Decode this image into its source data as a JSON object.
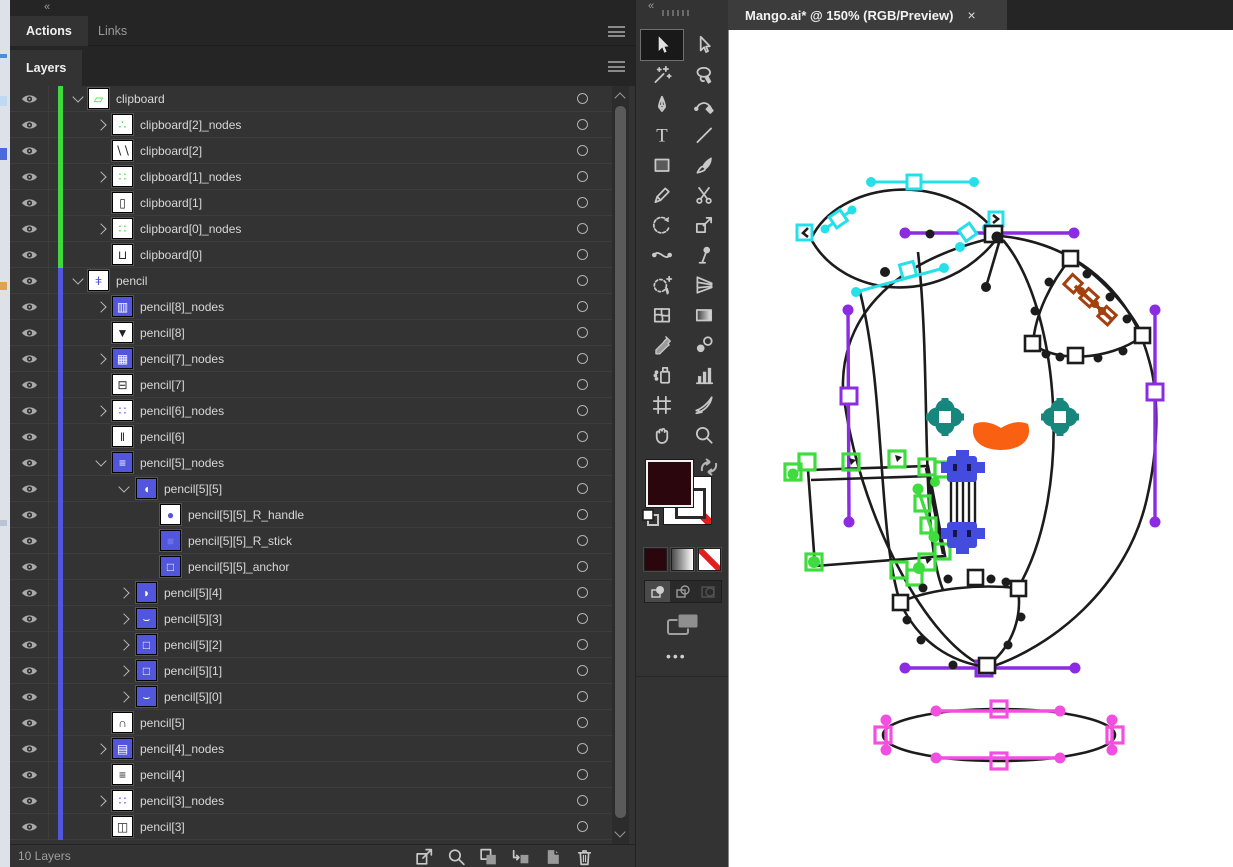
{
  "theme": {
    "panel-bg": "#333333",
    "panel-dark": "#252526",
    "row-line": "#3d3d3d",
    "text": "#d8d8d8",
    "dim": "#8f8f8f",
    "icon": "#bdbdbd",
    "accent-green": "#3fd83f",
    "accent-blue": "#5156dd",
    "tab-bg": "#3c3c3c",
    "fill-maroon": "#2b060c",
    "art-k": "#1c1c1c",
    "art-cyan": "#25dfe9",
    "art-purple": "#8b2be2",
    "art-brown": "#a34010",
    "art-teal": "#17877d",
    "art-orange": "#f96011",
    "art-green": "#3fdc3f",
    "art-blue": "#444ce0",
    "art-pink": "#f24fe0"
  },
  "header": {
    "collapse_left": "«",
    "collapse_toolbar": "«"
  },
  "panel": {
    "tabs": [
      {
        "label": "Actions",
        "active": true
      },
      {
        "label": "Links",
        "active": false
      }
    ],
    "layers_tab": "Layers",
    "status_count": "10 Layers",
    "footer_icons": [
      "collect-for-export",
      "search",
      "make-clip-mask",
      "new-sublayer",
      "new-layer",
      "delete"
    ]
  },
  "layers": {
    "rows": [
      {
        "label": "clipboard",
        "accent": "green",
        "level": 0,
        "exp": "open",
        "thumb": {
          "bg": "#ffffff",
          "fg": "#3fd83f",
          "glyph": "▱"
        }
      },
      {
        "label": "clipboard[2]_nodes",
        "accent": "green",
        "level": 1,
        "exp": "closed",
        "thumb": {
          "bg": "#ffffff",
          "fg": "#3fd83f",
          "glyph": "∴"
        }
      },
      {
        "label": "clipboard[2]",
        "accent": "green",
        "level": 1,
        "exp": "none",
        "thumb": {
          "bg": "#ffffff",
          "fg": "#222222",
          "glyph": "∖∖"
        }
      },
      {
        "label": "clipboard[1]_nodes",
        "accent": "green",
        "level": 1,
        "exp": "closed",
        "thumb": {
          "bg": "#ffffff",
          "fg": "#3fd83f",
          "glyph": "∷"
        }
      },
      {
        "label": "clipboard[1]",
        "accent": "green",
        "level": 1,
        "exp": "none",
        "thumb": {
          "bg": "#ffffff",
          "fg": "#222222",
          "glyph": "▯"
        }
      },
      {
        "label": "clipboard[0]_nodes",
        "accent": "green",
        "level": 1,
        "exp": "closed",
        "thumb": {
          "bg": "#ffffff",
          "fg": "#3fd83f",
          "glyph": "∷"
        }
      },
      {
        "label": "clipboard[0]",
        "accent": "green",
        "level": 1,
        "exp": "none",
        "thumb": {
          "bg": "#ffffff",
          "fg": "#222222",
          "glyph": "⊔"
        }
      },
      {
        "label": "pencil",
        "accent": "blue",
        "level": 0,
        "exp": "open",
        "thumb": {
          "bg": "#ffffff",
          "fg": "#5156dd",
          "glyph": "ǂ"
        }
      },
      {
        "label": "pencil[8]_nodes",
        "accent": "blue",
        "level": 1,
        "exp": "closed",
        "thumb": {
          "bg": "#5156dd",
          "fg": "#ffffff",
          "glyph": "▥"
        }
      },
      {
        "label": "pencil[8]",
        "accent": "blue",
        "level": 1,
        "exp": "none",
        "thumb": {
          "bg": "#ffffff",
          "fg": "#222222",
          "glyph": "▼"
        }
      },
      {
        "label": "pencil[7]_nodes",
        "accent": "blue",
        "level": 1,
        "exp": "closed",
        "thumb": {
          "bg": "#5156dd",
          "fg": "#ffffff",
          "glyph": "▦"
        }
      },
      {
        "label": "pencil[7]",
        "accent": "blue",
        "level": 1,
        "exp": "none",
        "thumb": {
          "bg": "#ffffff",
          "fg": "#222222",
          "glyph": "⊟"
        }
      },
      {
        "label": "pencil[6]_nodes",
        "accent": "blue",
        "level": 1,
        "exp": "closed",
        "thumb": {
          "bg": "#ffffff",
          "fg": "#5156dd",
          "glyph": "∷"
        }
      },
      {
        "label": "pencil[6]",
        "accent": "blue",
        "level": 1,
        "exp": "none",
        "thumb": {
          "bg": "#ffffff",
          "fg": "#222222",
          "glyph": "‖"
        }
      },
      {
        "label": "pencil[5]_nodes",
        "accent": "blue",
        "level": 1,
        "exp": "open",
        "thumb": {
          "bg": "#5156dd",
          "fg": "#ffffff",
          "glyph": "≡"
        }
      },
      {
        "label": "pencil[5][5]",
        "accent": "blue",
        "level": 2,
        "exp": "open",
        "thumb": {
          "bg": "#5156dd",
          "fg": "#ffffff",
          "glyph": "◖"
        }
      },
      {
        "label": "pencil[5][5]_R_handle",
        "accent": "blue",
        "level": 3,
        "exp": "none",
        "thumb": {
          "bg": "#ffffff",
          "fg": "#5156dd",
          "glyph": "●"
        }
      },
      {
        "label": "pencil[5][5]_R_stick",
        "accent": "blue",
        "level": 3,
        "exp": "none",
        "thumb": {
          "bg": "#5156dd",
          "fg": "#6a6fe8",
          "glyph": "■"
        }
      },
      {
        "label": "pencil[5][5]_anchor",
        "accent": "blue",
        "level": 3,
        "exp": "none",
        "thumb": {
          "bg": "#5156dd",
          "fg": "#ffffff",
          "glyph": "□"
        }
      },
      {
        "label": "pencil[5][4]",
        "accent": "blue",
        "level": 2,
        "exp": "closed",
        "thumb": {
          "bg": "#5156dd",
          "fg": "#ffffff",
          "glyph": "◗"
        }
      },
      {
        "label": "pencil[5][3]",
        "accent": "blue",
        "level": 2,
        "exp": "closed",
        "thumb": {
          "bg": "#5156dd",
          "fg": "#ffffff",
          "glyph": "⌣"
        }
      },
      {
        "label": "pencil[5][2]",
        "accent": "blue",
        "level": 2,
        "exp": "closed",
        "thumb": {
          "bg": "#5156dd",
          "fg": "#ffffff",
          "glyph": "□"
        }
      },
      {
        "label": "pencil[5][1]",
        "accent": "blue",
        "level": 2,
        "exp": "closed",
        "thumb": {
          "bg": "#5156dd",
          "fg": "#ffffff",
          "glyph": "□"
        }
      },
      {
        "label": "pencil[5][0]",
        "accent": "blue",
        "level": 2,
        "exp": "closed",
        "thumb": {
          "bg": "#5156dd",
          "fg": "#ffffff",
          "glyph": "⌣"
        }
      },
      {
        "label": "pencil[5]",
        "accent": "blue",
        "level": 1,
        "exp": "none",
        "thumb": {
          "bg": "#ffffff",
          "fg": "#222222",
          "glyph": "∩"
        }
      },
      {
        "label": "pencil[4]_nodes",
        "accent": "blue",
        "level": 1,
        "exp": "closed",
        "thumb": {
          "bg": "#5156dd",
          "fg": "#ffffff",
          "glyph": "▤"
        }
      },
      {
        "label": "pencil[4]",
        "accent": "blue",
        "level": 1,
        "exp": "none",
        "thumb": {
          "bg": "#ffffff",
          "fg": "#222222",
          "glyph": "≡"
        }
      },
      {
        "label": "pencil[3]_nodes",
        "accent": "blue",
        "level": 1,
        "exp": "closed",
        "thumb": {
          "bg": "#ffffff",
          "fg": "#5156dd",
          "glyph": "∷"
        }
      },
      {
        "label": "pencil[3]",
        "accent": "blue",
        "level": 1,
        "exp": "none",
        "thumb": {
          "bg": "#ffffff",
          "fg": "#222222",
          "glyph": "◫"
        }
      }
    ]
  },
  "toolbar": {
    "active_tool": "selection",
    "tools": [
      "selection",
      "direct-selection",
      "magic-wand",
      "lasso",
      "pen",
      "curvature",
      "type",
      "line",
      "rectangle",
      "paintbrush",
      "pencil",
      "scissors",
      "rotate",
      "scale",
      "width",
      "puppet-warp",
      "shape-builder",
      "perspective-grid",
      "mesh",
      "gradient",
      "eyedropper",
      "blend",
      "symbol-sprayer",
      "column-graph",
      "artboard",
      "slice",
      "hand",
      "zoom"
    ],
    "fill_color": "#2b060c",
    "stroke_style": "none",
    "swatch_buttons": [
      "color",
      "gradient",
      "none"
    ],
    "draw_modes": [
      "draw-normal",
      "draw-behind",
      "draw-inside"
    ],
    "ellipsis": "•••"
  },
  "document": {
    "tab_title": "Mango.ai* @ 150% (RGB/Preview)",
    "close_label": "×",
    "zoom_percent": "150%",
    "color_mode": "RGB/Preview"
  }
}
